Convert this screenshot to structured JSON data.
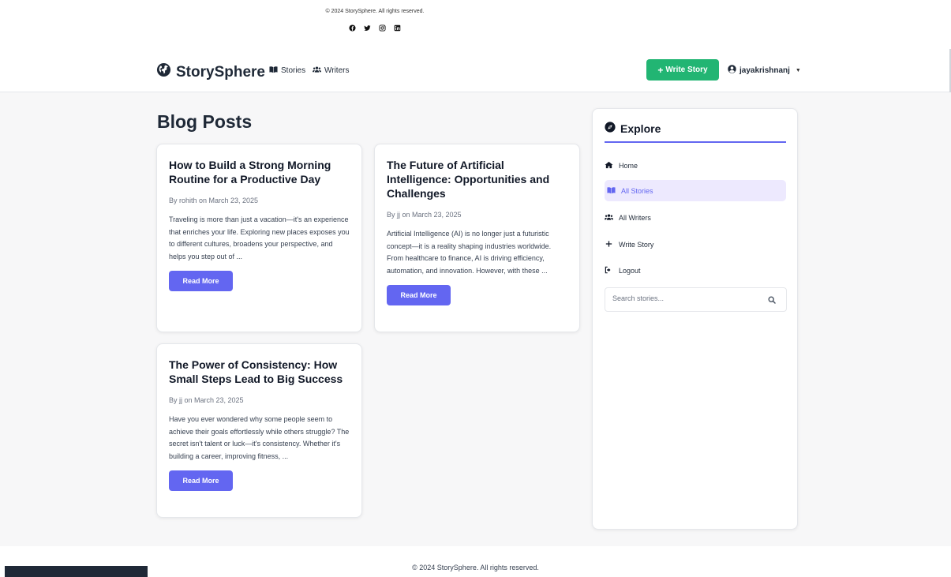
{
  "top": {
    "copyright": "© 2024 StorySphere. All rights reserved.",
    "social_icons": [
      "facebook-icon",
      "twitter-icon",
      "instagram-icon",
      "linkedin-icon"
    ]
  },
  "navbar": {
    "brand": "StorySphere",
    "links": [
      {
        "label": "Stories",
        "icon": "book-icon"
      },
      {
        "label": "Writers",
        "icon": "users-icon"
      }
    ],
    "write_button": "Write Story",
    "user": "jayakrishnanj"
  },
  "main": {
    "title": "Blog Posts",
    "posts": [
      {
        "title": "How to Build a Strong Morning Routine for a Productive Day",
        "meta": "By rohith on March 23, 2025",
        "excerpt": "Traveling is more than just a vacation—it's an experience that enriches your life. Exploring new places exposes you to different cultures, broadens your perspective, and helps you step out of ...",
        "button": "Read More"
      },
      {
        "title": "The Future of Artificial Intelligence: Opportunities and Challenges",
        "meta": "By jj on March 23, 2025",
        "excerpt": "Artificial Intelligence (AI) is no longer just a futuristic concept—it is a reality shaping industries worldwide. From healthcare to finance, AI is driving efficiency, automation, and innovation. However, with these ...",
        "button": "Read More"
      },
      {
        "title": "The Power of Consistency: How Small Steps Lead to Big Success",
        "meta": "By jj on March 23, 2025",
        "excerpt": "Have you ever wondered why some people seem to achieve their goals effortlessly while others struggle? The secret isn't talent or luck—it's consistency. Whether it's building a career, improving fitness, ...",
        "button": "Read More"
      }
    ]
  },
  "sidebar": {
    "title": "Explore",
    "items": [
      {
        "label": "Home",
        "icon": "home-icon",
        "active": false
      },
      {
        "label": "All Stories",
        "icon": "book-icon",
        "active": true
      },
      {
        "label": "All Writers",
        "icon": "users-icon",
        "active": false
      },
      {
        "label": "Write Story",
        "icon": "plus-icon",
        "active": false
      },
      {
        "label": "Logout",
        "icon": "logout-icon",
        "active": false
      }
    ],
    "search_placeholder": "Search stories..."
  },
  "footer": {
    "copyright": "© 2024 StorySphere. All rights reserved."
  },
  "colors": {
    "accent": "#6366f1",
    "write_button": "#22b573",
    "active_bg": "#ede9fe"
  }
}
